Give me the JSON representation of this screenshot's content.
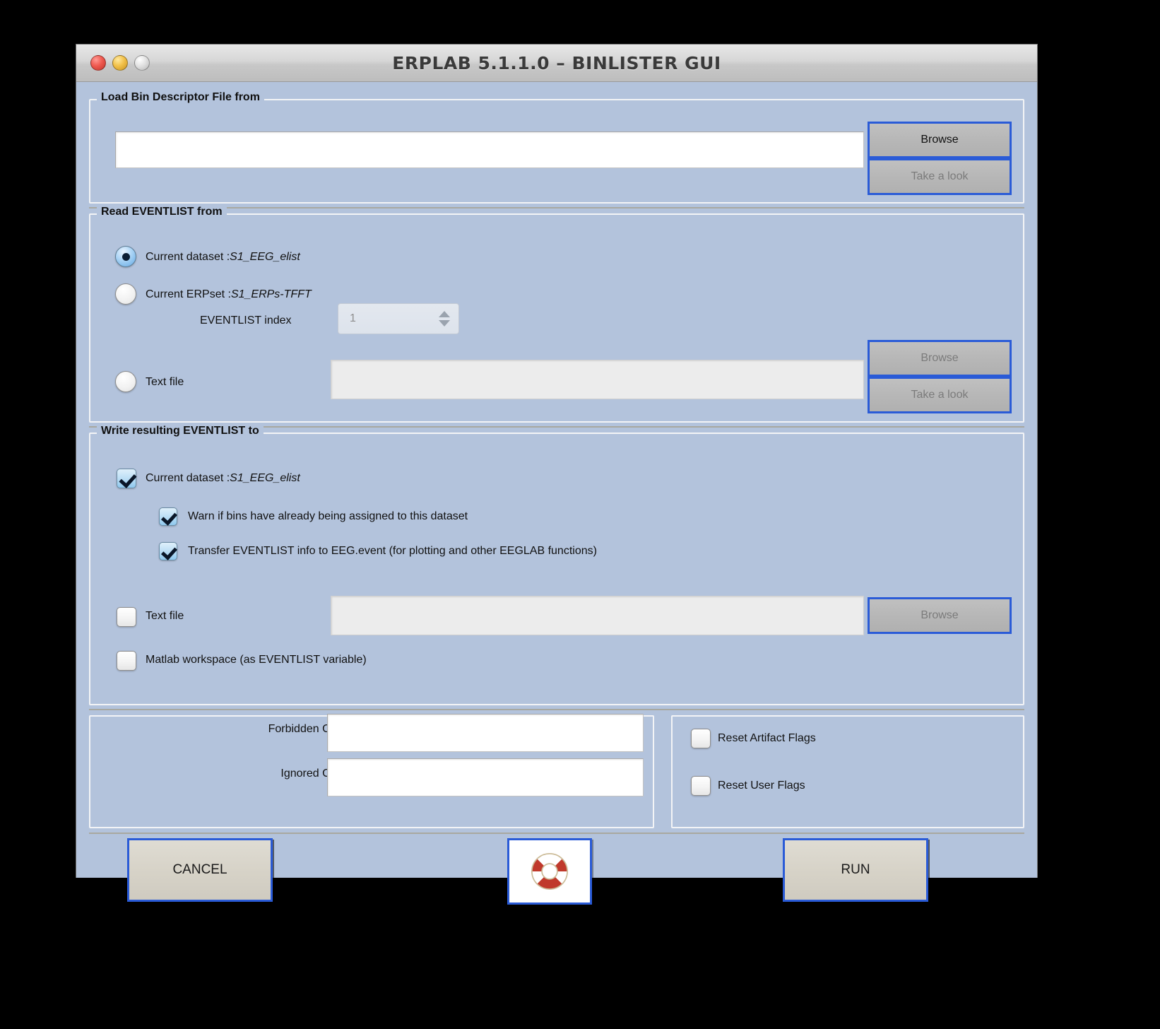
{
  "window": {
    "title": "ERPLAB 5.1.1.0  –   BINLISTER GUI",
    "traffic_lights": [
      "close-button",
      "minimize-button",
      "zoom-button"
    ]
  },
  "load_bdf_panel": {
    "legend": "Load Bin Descriptor File from",
    "path_value": "",
    "path_placeholder": "",
    "browse_label": "Browse",
    "take_a_look_label": "Take a look"
  },
  "read_eventlist_panel": {
    "legend": "Read EVENTLIST from",
    "options": [
      {
        "label_prefix": "Current dataset :",
        "value": "S1_EEG_elist",
        "selected": true
      },
      {
        "label_prefix": "Current ERPset :",
        "value": "S1_ERPs-TFFT",
        "selected": false
      },
      {
        "label_prefix": "Text file",
        "value": "",
        "selected": false
      }
    ],
    "eventlist_index_label": "EVENTLIST index",
    "eventlist_index_value": "1",
    "textfile_value": "",
    "browse_label": "Browse",
    "take_a_look_label": "Take a look"
  },
  "write_eventlist_panel": {
    "legend": "Write resulting EVENTLIST to",
    "current_dataset": {
      "label_prefix": "Current dataset :",
      "value": "S1_EEG_elist",
      "checked": true
    },
    "warn_bins": {
      "label": "Warn if bins have already being assigned to this dataset",
      "checked": true
    },
    "transfer_eventlist": {
      "label": "Transfer EVENTLIST info to EEG.event (for plotting and other EEGLAB functions)",
      "checked": true
    },
    "text_file": {
      "label": "Text file",
      "checked": false,
      "value": "",
      "browse_label": "Browse"
    },
    "matlab_workspace": {
      "label": "Matlab workspace (as EVENTLIST variable)",
      "checked": false
    }
  },
  "codes_panel": {
    "forbidden_label": "Forbidden Code(s)",
    "forbidden_value": "",
    "ignored_label": "Ignored Code(s)",
    "ignored_value": ""
  },
  "flags_panel": {
    "reset_artifact_flags": {
      "label": "Reset Artifact Flags",
      "checked": false
    },
    "reset_user_flags": {
      "label": "Reset User Flags",
      "checked": false
    }
  },
  "footer": {
    "cancel_label": "CANCEL",
    "help_icon": "lifesaver-icon",
    "run_label": "RUN"
  },
  "colors": {
    "window_background": "#b3c3dc",
    "panel_border": "#f3f4f6",
    "button_focus_border": "#2a5bd7",
    "button_face": "#b7b7b7",
    "action_button_face": "#d7d3c8",
    "field_background": "#ffffff",
    "field_disabled_background": "#ececec",
    "checkbox_checked": "#b9ddf5",
    "radio_checked": "#a9d3f5",
    "disabled_text": "#7b7b7b"
  }
}
